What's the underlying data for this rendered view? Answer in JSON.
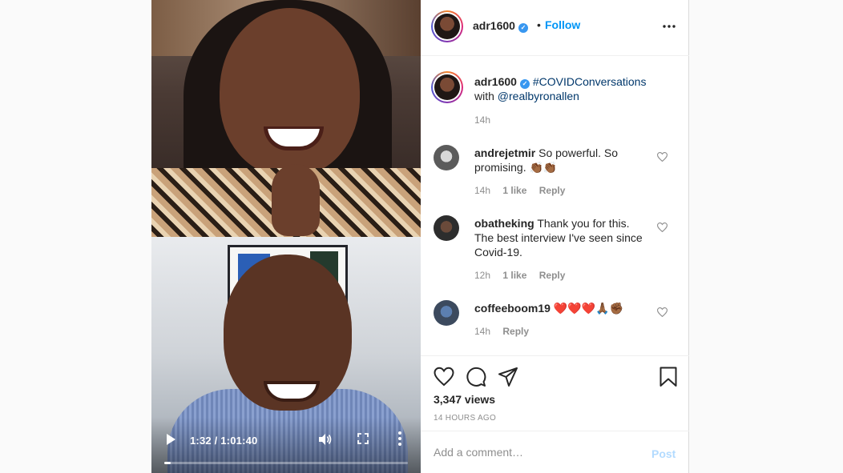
{
  "video": {
    "time": "1:32 / 1:01:40",
    "progress_fraction": 0.025
  },
  "header": {
    "username": "adr1600",
    "separator": "•",
    "follow_label": "Follow"
  },
  "caption": {
    "username": "adr1600",
    "hashtag": "#COVIDConversations",
    "text_with": "with",
    "mention": "@realbyronallen",
    "time": "14h"
  },
  "comments": [
    {
      "username": "andrejetmir",
      "text": "So powerful. So promising. 👏🏾👏🏾",
      "time": "14h",
      "likes": "1 like",
      "reply": "Reply"
    },
    {
      "username": "obatheking",
      "text": "Thank you for this. The best interview I've seen since Covid-19.",
      "time": "12h",
      "likes": "1 like",
      "reply": "Reply"
    },
    {
      "username": "coffeeboom19",
      "text": "❤️❤️❤️🙏🏾✊🏾",
      "time": "14h",
      "reply": "Reply"
    }
  ],
  "actions": {
    "views": "3,347 views",
    "date": "14 HOURS AGO"
  },
  "add_comment": {
    "placeholder": "Add a comment…",
    "post_label": "Post"
  },
  "colors": {
    "accent": "#0095f6",
    "post_disabled": "#b3dbff",
    "muted": "#8e8e8e"
  },
  "icons": [
    "play-icon",
    "volume-icon",
    "fullscreen-icon",
    "more-vertical-icon",
    "more-horizontal-icon",
    "verified-icon",
    "heart-icon",
    "comment-icon",
    "share-icon",
    "bookmark-icon"
  ]
}
